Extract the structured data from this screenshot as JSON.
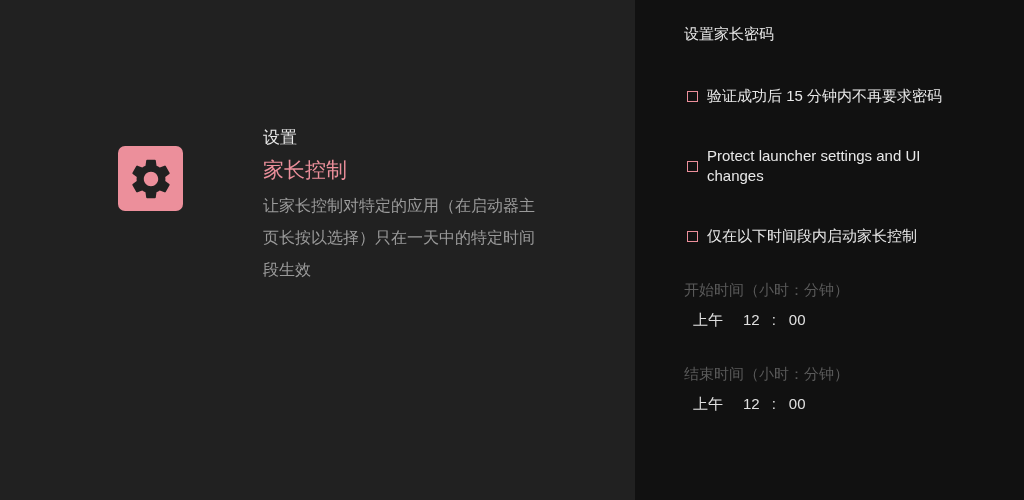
{
  "info": {
    "breadcrumb": "设置",
    "title": "家长控制",
    "description": "让家长控制对特定的应用（在启动器主页长按以选择）只在一天中的特定时间段生效"
  },
  "panel": {
    "heading": "设置家长密码",
    "options": [
      {
        "label": "验证成功后 15 分钟内不再要求密码",
        "checked": false
      },
      {
        "label": "Protect launcher settings and UI changes",
        "checked": false
      },
      {
        "label": "仅在以下时间段内启动家长控制",
        "checked": false
      }
    ],
    "times": [
      {
        "label": "开始时间（小时：分钟）",
        "disabled": true,
        "period": "上午",
        "hour": "12",
        "separator": ":",
        "minute": "00"
      },
      {
        "label": "结束时间（小时：分钟）",
        "disabled": true,
        "period": "上午",
        "hour": "12",
        "separator": ":",
        "minute": "00"
      }
    ]
  }
}
